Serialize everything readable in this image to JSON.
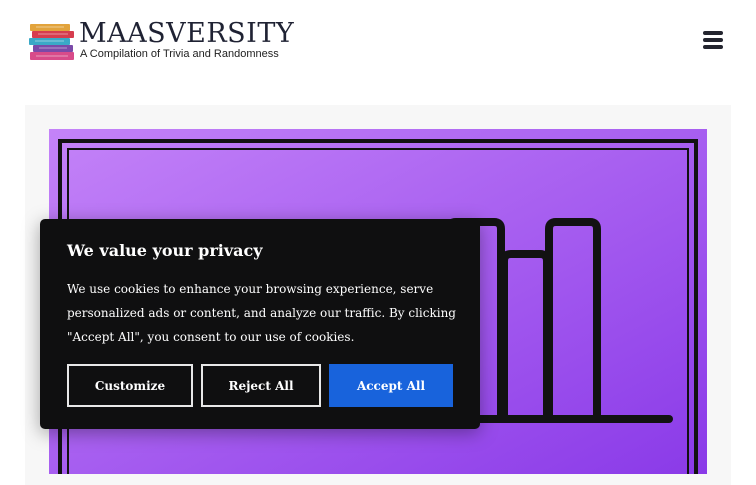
{
  "header": {
    "logo_title": "MAASVERSITY",
    "logo_subtitle": "A Compilation of Trivia and Randomness",
    "menu_icon": "hamburger-menu-icon"
  },
  "featured_image": {
    "description_icon": "bar-chart-icon",
    "gradient_start": "#c483f8",
    "gradient_end": "#8a3ae8"
  },
  "cookie_banner": {
    "title": "We value your privacy",
    "text": "We use cookies to enhance your browsing experience, serve personalized ads or content, and analyze our traffic. By clicking \"Accept All\", you consent to our use of cookies.",
    "customize_label": "Customize",
    "reject_label": "Reject All",
    "accept_label": "Accept All",
    "accent_color": "#1863dc"
  }
}
